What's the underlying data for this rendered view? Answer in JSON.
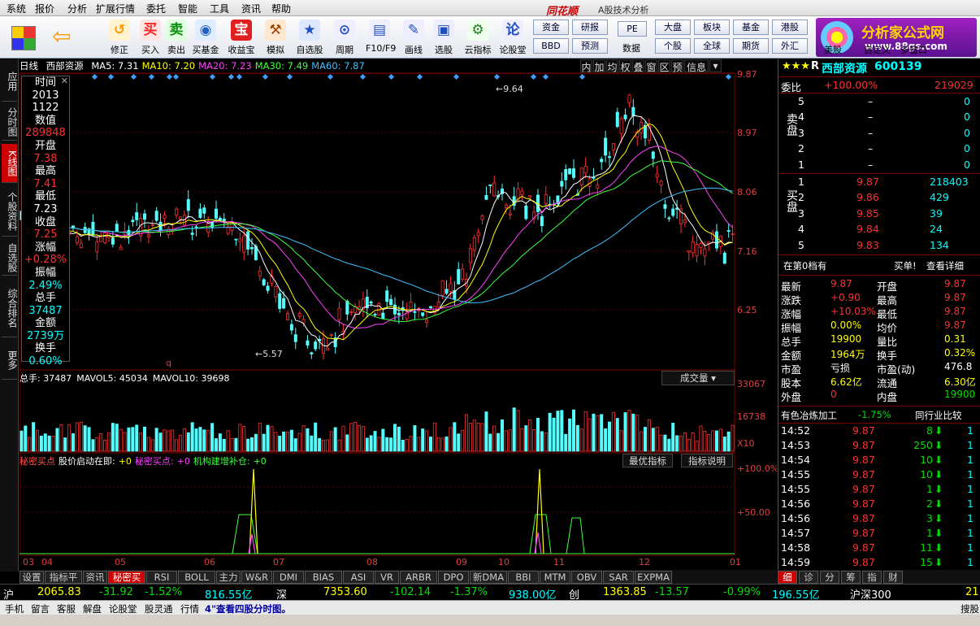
{
  "menu": [
    "系统",
    "报价",
    "分析",
    "扩展行情",
    "委托",
    "智能",
    "工具",
    "资讯",
    "帮助"
  ],
  "app_title": "同花顺",
  "app_subtitle": "A股技术分析",
  "toolbar": {
    "buttons": [
      "修正",
      "买入",
      "卖出",
      "买基金",
      "收益宝",
      "模拟",
      "自选股",
      "周期",
      "F10/F9",
      "画线",
      "选股",
      "云指标",
      "论股堂"
    ],
    "small_buttons": [
      [
        "资金",
        "研报",
        "大盘",
        "板块",
        "基金",
        "港股"
      ],
      [
        "BBD",
        "预测",
        "个股",
        "全球",
        "期货",
        "外汇"
      ]
    ],
    "extra": [
      "数据",
      "美股",
      "自定义",
      "多窗口"
    ],
    "logo_main": "分析家公式网",
    "logo_url": "www.88gs.com"
  },
  "left_tabs": [
    "应用",
    "分时图",
    "K线图",
    "个股资料",
    "自选股",
    "综合排名",
    "更多"
  ],
  "chart": {
    "period": "日线",
    "name": "西部资源",
    "ma": [
      {
        "label": "MA5: 7.31",
        "color": "#ffffff"
      },
      {
        "label": "MA10: 7.20",
        "color": "#ffff00"
      },
      {
        "label": "MA20: 7.23",
        "color": "#ff40ff"
      },
      {
        "label": "MA30: 7.49",
        "color": "#40ff40"
      },
      {
        "label": "MA60: 7.87",
        "color": "#40c0ff"
      }
    ],
    "ind_btns": [
      "内",
      "加",
      "均",
      "权",
      "叠",
      "窗",
      "区",
      "预",
      "信息"
    ],
    "databox": [
      [
        "时间",
        "w"
      ],
      [
        "2013",
        "w"
      ],
      [
        "1122",
        "w"
      ],
      [
        "数值",
        "w"
      ],
      [
        "289848",
        "r"
      ],
      [
        "开盘",
        "w"
      ],
      [
        "7.38",
        "r"
      ],
      [
        "最高",
        "w"
      ],
      [
        "7.41",
        "r"
      ],
      [
        "最低",
        "w"
      ],
      [
        "7.23",
        "w"
      ],
      [
        "收盘",
        "w"
      ],
      [
        "7.25",
        "r"
      ],
      [
        "涨幅",
        "w"
      ],
      [
        "+0.28%",
        "r"
      ],
      [
        "振幅",
        "w"
      ],
      [
        "2.49%",
        "c"
      ],
      [
        "总手",
        "w"
      ],
      [
        "37487",
        "c"
      ],
      [
        "金额",
        "w"
      ],
      [
        "2739万",
        "c"
      ],
      [
        "换手",
        "w"
      ],
      [
        "0.60%",
        "c"
      ]
    ],
    "price_ticks": [
      "9.87",
      "8.97",
      "8.06",
      "7.16",
      "6.25"
    ],
    "high_label": "9.64",
    "low_label": "5.57",
    "q_mark": "q",
    "vol_header": [
      "总手: 37487",
      "MAVOL5: 45034",
      "MAVOL10: 39698"
    ],
    "vol_btn": "成交量",
    "vol_ticks": [
      "33067",
      "16738",
      "X10"
    ],
    "sec_header": [
      [
        "秘密买点",
        "#ff5050"
      ],
      [
        "股价启动在即:",
        "#ffffff"
      ],
      [
        "+0",
        "#ffff00"
      ],
      [
        "秘密买点:",
        "#ff40ff"
      ],
      [
        "+0",
        "#ff40ff"
      ],
      [
        "机构建增补仓:",
        "#40ff40"
      ],
      [
        "+0",
        "#40ff40"
      ]
    ],
    "sec_btns": [
      "最优指标",
      "指标说明"
    ],
    "sec_ticks": [
      "+100.0%",
      "+50.00"
    ],
    "months": [
      "03",
      "04",
      "05",
      "06",
      "07",
      "08",
      "09",
      "10",
      "11",
      "12",
      "01"
    ],
    "bottom_tabs": [
      "设置",
      "指标平台",
      "资讯",
      "秘密买点",
      "RSI",
      "BOLL",
      "主力",
      "W&R",
      "DMI",
      "BIAS",
      "ASI",
      "VR",
      "ARBR",
      "DPO",
      "新DMA",
      "BBI",
      "MTM",
      "OBV",
      "SAR",
      "EXPMA"
    ]
  },
  "chart_data": {
    "type": "candlestick",
    "stock": "西部资源",
    "period": "日线",
    "ylim": [
      5.57,
      9.87
    ],
    "high": 9.64,
    "low": 5.57,
    "last": {
      "date": "2013-11-22",
      "open": 7.38,
      "high": 7.41,
      "low": 7.23,
      "close": 7.25,
      "change": "+0.28%"
    },
    "volume_axis": [
      "33067",
      "16738"
    ]
  },
  "quote": {
    "stars": "★★★",
    "r": "R",
    "name": "西部资源",
    "code": "600139",
    "wb": [
      "委比",
      "+100.00%",
      "219029"
    ],
    "sell": [
      [
        "5",
        "–",
        "0"
      ],
      [
        "4",
        "–",
        "0"
      ],
      [
        "3",
        "–",
        "0"
      ],
      [
        "2",
        "–",
        "0"
      ],
      [
        "1",
        "–",
        "0"
      ]
    ],
    "buy": [
      [
        "1",
        "9.87",
        "218403"
      ],
      [
        "2",
        "9.86",
        "429"
      ],
      [
        "3",
        "9.85",
        "39"
      ],
      [
        "4",
        "9.84",
        "24"
      ],
      [
        "5",
        "9.83",
        "134"
      ]
    ],
    "sell_label": "卖盘",
    "buy_label": "买盘",
    "queue": [
      "在第0档有",
      "买单!",
      "查看详细"
    ],
    "stats": [
      [
        "最新",
        "9.87",
        "r",
        "开盘",
        "9.87",
        "r"
      ],
      [
        "涨跌",
        "+0.90",
        "r",
        "最高",
        "9.87",
        "r"
      ],
      [
        "涨幅",
        "+10.03%",
        "r",
        "最低",
        "9.87",
        "r"
      ],
      [
        "振幅",
        "0.00%",
        "y",
        "均价",
        "9.87",
        "r"
      ],
      [
        "总手",
        "19900",
        "y",
        "量比",
        "0.31",
        "y"
      ],
      [
        "金额",
        "1964万",
        "y",
        "换手",
        "0.32%",
        "y"
      ],
      [
        "市盈",
        "亏损",
        "w",
        "市盈(动)",
        "476.8",
        "w"
      ],
      [
        "股本",
        "6.62亿",
        "y",
        "流通",
        "6.30亿",
        "y"
      ],
      [
        "外盘",
        "0",
        "r",
        "内盘",
        "19900",
        "g"
      ]
    ],
    "industry": [
      "有色冶炼加工",
      "-1.75%",
      "同行业比较"
    ],
    "ticks": [
      [
        "14:52",
        "9.87",
        "8"
      ],
      [
        "14:53",
        "9.87",
        "250"
      ],
      [
        "14:54",
        "9.87",
        "10"
      ],
      [
        "14:55",
        "9.87",
        "10"
      ],
      [
        "14:55",
        "9.87",
        "1"
      ],
      [
        "14:56",
        "9.87",
        "2"
      ],
      [
        "14:56",
        "9.87",
        "3"
      ],
      [
        "14:57",
        "9.87",
        "1"
      ],
      [
        "14:58",
        "9.87",
        "11"
      ],
      [
        "14:59",
        "9.87",
        "15"
      ]
    ],
    "tick_tail": "1",
    "tabs": [
      "细",
      "诊",
      "分",
      "筹",
      "指",
      "财"
    ]
  },
  "ticker": [
    [
      "沪",
      "w"
    ],
    [
      "2065.83",
      "y"
    ],
    [
      "-31.92",
      "g"
    ],
    [
      "-1.52%",
      "g"
    ],
    [
      "816.55亿",
      "c"
    ],
    [
      "深",
      "w"
    ],
    [
      "7353.60",
      "y"
    ],
    [
      "-102.14",
      "g"
    ],
    [
      "-1.37%",
      "g"
    ],
    [
      "938.00亿",
      "c"
    ],
    [
      "创",
      "w"
    ],
    [
      "1363.85",
      "y"
    ],
    [
      "-13.57",
      "g"
    ],
    [
      "-0.99%",
      "g"
    ],
    [
      "196.55亿",
      "c"
    ],
    [
      "沪深300",
      "w"
    ],
    [
      "21",
      "y"
    ]
  ],
  "status": [
    "手机",
    "留言",
    "客服",
    "解盘",
    "论股堂",
    "股灵通",
    "行情",
    "4\"查看四股分时图。",
    "搜股"
  ],
  "colors": {
    "up": "#ff3030",
    "down": "#54ffff",
    "bg": "#000000",
    "grid": "#700000"
  }
}
